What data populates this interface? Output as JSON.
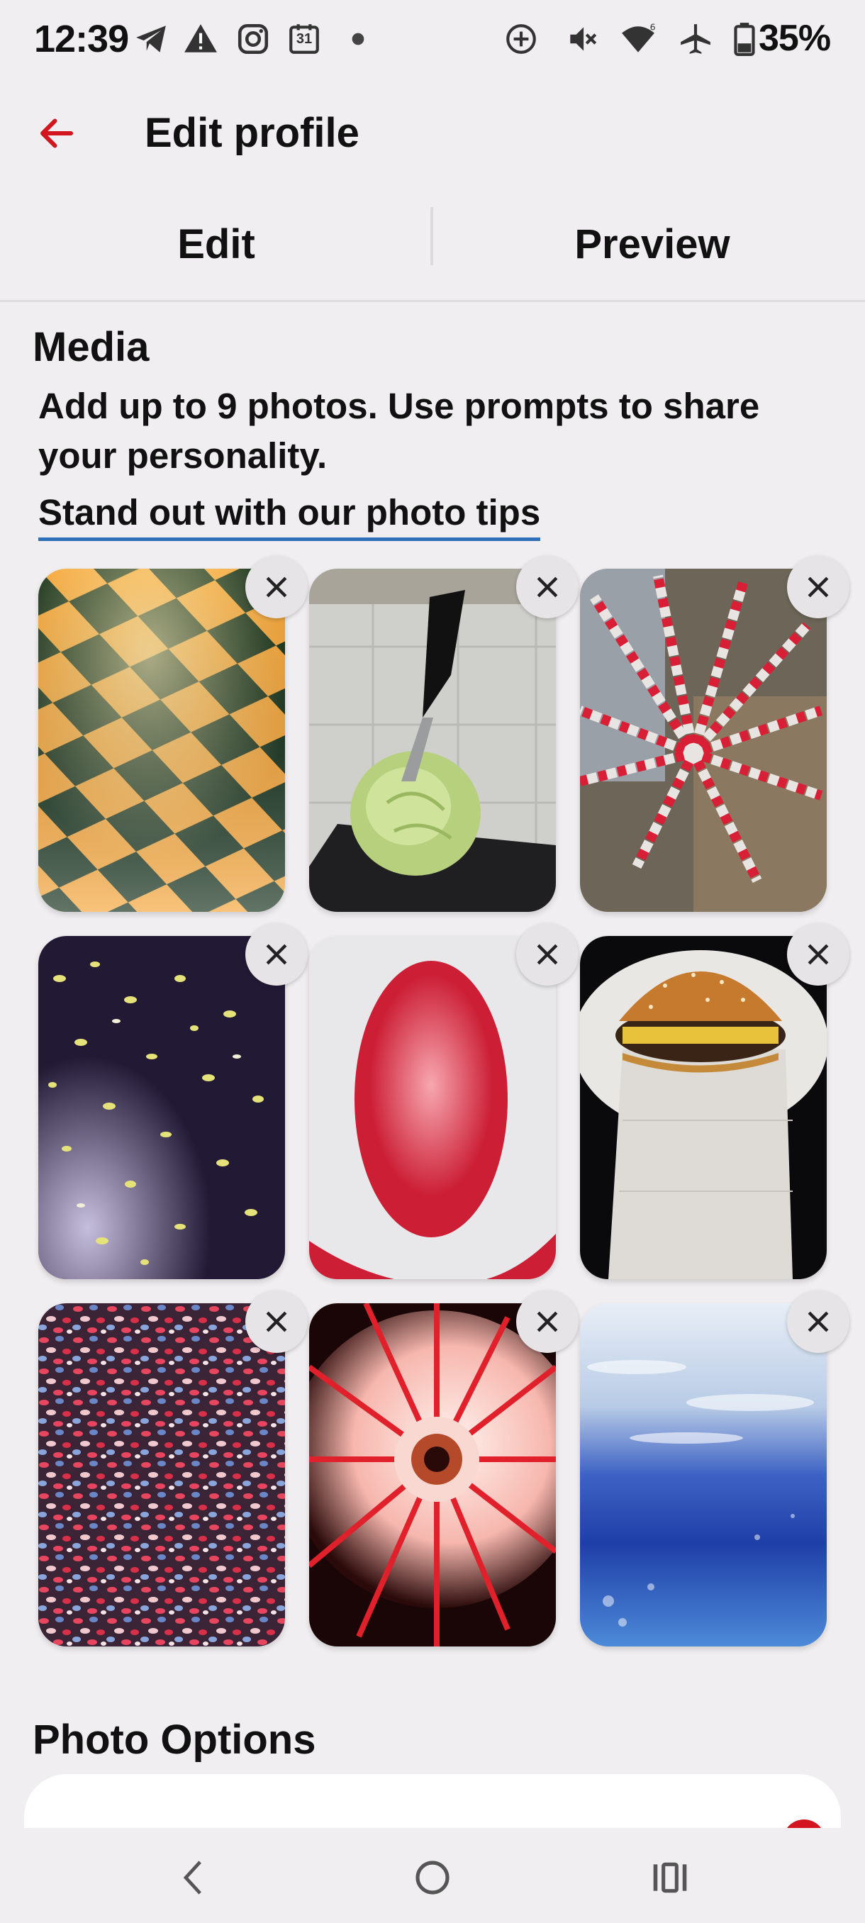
{
  "status_bar": {
    "time": "12:39",
    "battery": "35%",
    "left_icons": [
      "telegram-icon",
      "warning-icon",
      "instagram-icon",
      "calendar-icon",
      "dot-icon"
    ],
    "calendar_day": "31",
    "right_icons": [
      "data-saver-icon",
      "vibrate-off-icon",
      "wifi-icon",
      "airplane-icon",
      "battery-icon"
    ]
  },
  "header": {
    "back_icon": "arrow-left-icon",
    "title": "Edit profile",
    "accent_color": "#d3151f"
  },
  "tabs": [
    {
      "label": "Edit",
      "selected": true
    },
    {
      "label": "Preview",
      "selected": false
    }
  ],
  "media": {
    "title": "Media",
    "description": "Add up to 9 photos. Use prompts to share your personality.",
    "tips_link": "Stand out with our photo tips",
    "link_color": "#2d6fb8",
    "photos": [
      {
        "subject": "checkerboard-floor"
      },
      {
        "subject": "cabbage-with-knife"
      },
      {
        "subject": "red-white-tape-window"
      },
      {
        "subject": "leaves-on-car"
      },
      {
        "subject": "red-oval"
      },
      {
        "subject": "burger-on-napkin"
      },
      {
        "subject": "confetti-pattern"
      },
      {
        "subject": "red-light-fixture"
      },
      {
        "subject": "blue-water"
      }
    ],
    "remove_icon": "close-icon"
  },
  "photo_options": {
    "title": "Photo Options"
  },
  "nav_bar": {
    "icons": [
      "back-nav-icon",
      "home-nav-icon",
      "recents-nav-icon"
    ]
  }
}
